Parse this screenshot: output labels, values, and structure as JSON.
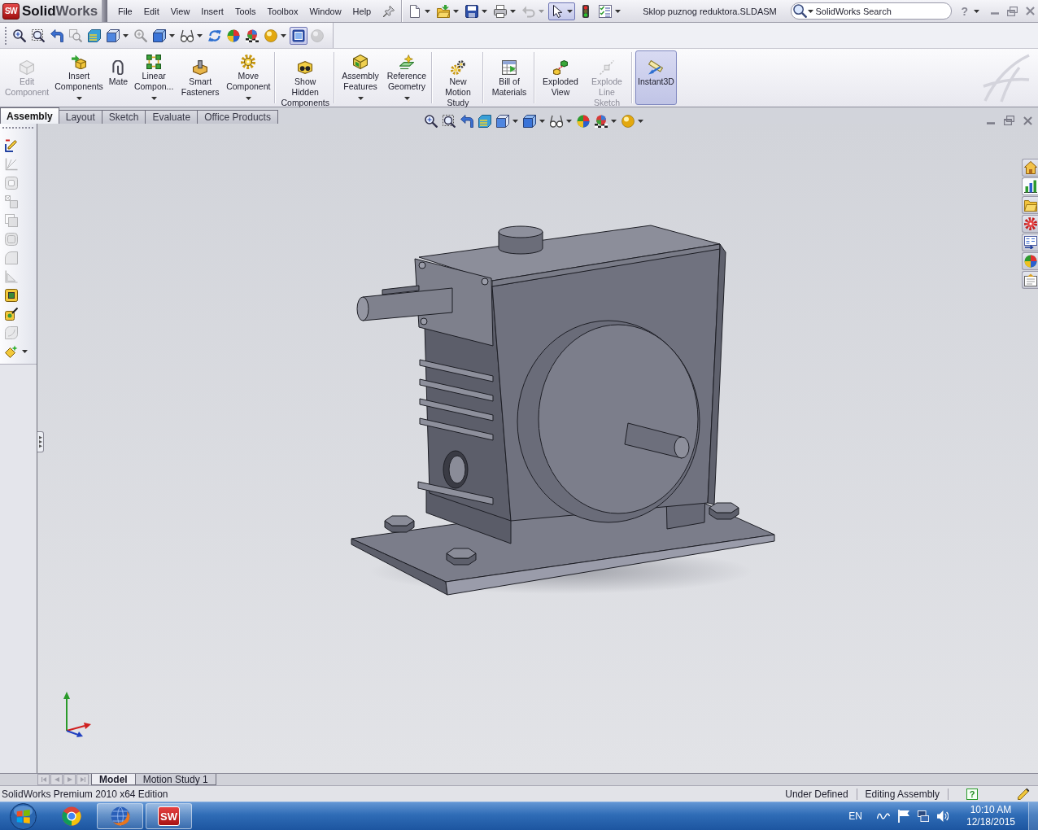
{
  "title_bar": {
    "logo_badge": "SW",
    "logo": "**Solid**Works",
    "menu": [
      "File",
      "Edit",
      "View",
      "Insert",
      "Tools",
      "Toolbox",
      "Window",
      "Help"
    ],
    "quick_access": [
      {
        "selected": false,
        "disabled": false
      },
      {
        "selected": false,
        "disabled": false
      },
      {
        "selected": false,
        "disabled": false
      },
      {
        "selected": false,
        "disabled": false
      },
      {
        "selected": false,
        "disabled": true
      },
      {
        "selected": true,
        "disabled": false
      },
      {
        "selected": false,
        "disabled": false
      },
      {
        "selected": false,
        "disabled": false
      }
    ],
    "document_title": "Sklop puznog reduktora.SLDASM",
    "search": {
      "placeholder": "SolidWorks Search"
    },
    "help": "?"
  },
  "view_toolbar": [
    {
      "selected": false,
      "disabled": false
    },
    {
      "selected": false,
      "disabled": false
    },
    {
      "selected": false,
      "disabled": false
    },
    {
      "selected": false,
      "disabled": true
    },
    {
      "selected": false,
      "disabled": false
    },
    {
      "selected": false,
      "disabled": false
    },
    {
      "selected": false,
      "disabled": true
    },
    {
      "selected": false,
      "disabled": false
    },
    {
      "selected": false,
      "disabled": false
    },
    {
      "selected": false,
      "disabled": false
    },
    {
      "selected": false,
      "disabled": false
    },
    {
      "selected": false,
      "disabled": false
    },
    {
      "selected": false,
      "disabled": false
    },
    {
      "selected": true,
      "disabled": false
    },
    {
      "selected": false,
      "disabled": true
    }
  ],
  "command_manager": {
    "groups": [
      {
        "buttons": [
          {
            "label": "Edit Component",
            "disabled": true,
            "selected": false,
            "has_menu": false
          },
          {
            "label": "Insert Components",
            "disabled": false,
            "selected": false,
            "has_menu": true
          },
          {
            "label": "Mate",
            "disabled": false,
            "selected": false,
            "has_menu": false
          },
          {
            "label": "Linear Compon...",
            "disabled": false,
            "selected": false,
            "has_menu": true
          },
          {
            "label": "Smart Fasteners",
            "disabled": false,
            "selected": false,
            "has_menu": false
          },
          {
            "label": "Move Component",
            "disabled": false,
            "selected": false,
            "has_menu": true
          }
        ]
      },
      {
        "buttons": [
          {
            "label": "Show Hidden Components",
            "disabled": false,
            "selected": false,
            "has_menu": false
          }
        ]
      },
      {
        "buttons": [
          {
            "label": "Assembly Features",
            "disabled": false,
            "selected": false,
            "has_menu": true
          },
          {
            "label": "Reference Geometry",
            "disabled": false,
            "selected": false,
            "has_menu": true
          }
        ]
      },
      {
        "buttons": [
          {
            "label": "New Motion Study",
            "disabled": false,
            "selected": false,
            "has_menu": false
          }
        ]
      },
      {
        "buttons": [
          {
            "label": "Bill of Materials",
            "disabled": false,
            "selected": false,
            "has_menu": false
          }
        ]
      },
      {
        "buttons": [
          {
            "label": "Exploded View",
            "disabled": false,
            "selected": false,
            "has_menu": false
          },
          {
            "label": "Explode Line Sketch",
            "disabled": true,
            "selected": false,
            "has_menu": false
          }
        ]
      },
      {
        "buttons": [
          {
            "label": "Instant3D",
            "disabled": false,
            "selected": true,
            "has_menu": false
          }
        ]
      }
    ]
  },
  "tabs": [
    {
      "label": "Assembly",
      "selected": true
    },
    {
      "label": "Layout",
      "selected": false
    },
    {
      "label": "Sketch",
      "selected": false
    },
    {
      "label": "Evaluate",
      "selected": false
    },
    {
      "label": "Office Products",
      "selected": false
    }
  ],
  "side_toolbar": [
    {
      "disabled": false
    },
    {
      "disabled": true
    },
    {
      "disabled": true
    },
    {
      "disabled": true
    },
    {
      "disabled": true
    },
    {
      "disabled": true
    },
    {
      "disabled": true
    },
    {
      "disabled": true
    },
    {
      "disabled": false
    },
    {
      "disabled": false
    },
    {
      "disabled": true
    },
    {
      "disabled": false
    }
  ],
  "task_pane_tabs": [
    {
      "selected": false
    },
    {
      "selected": true
    },
    {
      "selected": false
    },
    {
      "selected": false
    },
    {
      "selected": false
    },
    {
      "selected": false
    },
    {
      "selected": false
    }
  ],
  "bottom_tabs": [
    {
      "label": "Model",
      "selected": true
    },
    {
      "label": "Motion Study 1",
      "selected": false
    }
  ],
  "status_bar": {
    "edition": "SolidWorks Premium 2010 x64 Edition",
    "definition": "Under Defined",
    "mode": "Editing Assembly",
    "help": "?"
  },
  "taskbar": {
    "apps": [
      {
        "running": false
      },
      {
        "running": true
      },
      {
        "running": true,
        "badge": "SW"
      }
    ],
    "language": "EN",
    "time": "10:10 AM",
    "date": "12/18/2015"
  }
}
